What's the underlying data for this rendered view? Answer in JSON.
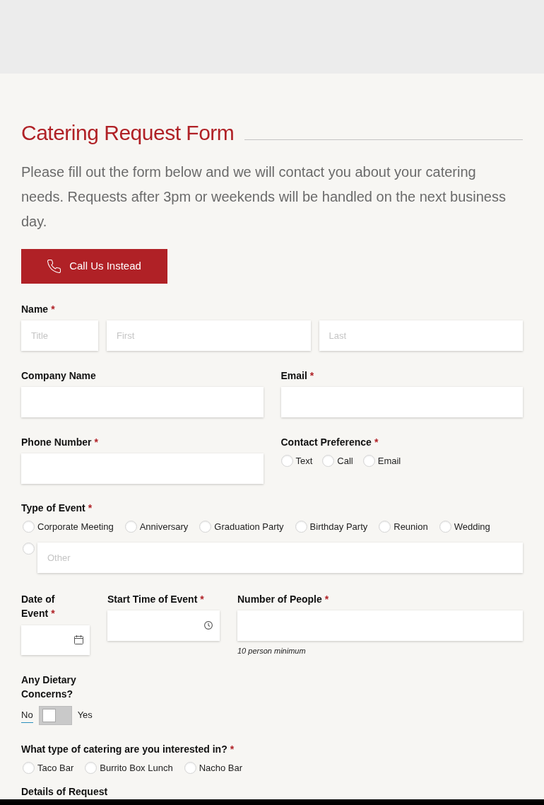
{
  "title": "Catering Request Form",
  "intro": "Please fill out the form below and we will contact you about your catering needs. Requests after 3pm or weekends will be handled on the next business day.",
  "call_button": {
    "label": "Call Us Instead"
  },
  "name": {
    "label": "Name",
    "required_mark": "*",
    "inputs": [
      {
        "placeholder": "Title"
      },
      {
        "placeholder": "First"
      },
      {
        "placeholder": "Last"
      }
    ]
  },
  "company_name": {
    "label": "Company Name"
  },
  "email": {
    "label": "Email",
    "required_mark": "*"
  },
  "phone_number": {
    "label": "Phone Number",
    "required_mark": "*"
  },
  "contact_preference": {
    "label": "Contact Preference",
    "required_mark": "*",
    "options": [
      {
        "label": "Text",
        "selected": false
      },
      {
        "label": "Call",
        "selected": false
      },
      {
        "label": "Email",
        "selected": false
      }
    ]
  },
  "type_of_event": {
    "label": "Type of Event",
    "required_mark": "*",
    "options": [
      {
        "label": "Corporate Meeting",
        "selected": false
      },
      {
        "label": "Anniversary",
        "selected": false
      },
      {
        "label": "Graduation Party",
        "selected": false
      },
      {
        "label": "Birthday Party",
        "selected": false
      },
      {
        "label": "Reunion",
        "selected": false
      },
      {
        "label": "Wedding",
        "selected": false
      }
    ],
    "other": {
      "placeholder": "Other",
      "selected": false
    }
  },
  "date_of_event": {
    "label": "Date of Event",
    "required_mark": "*"
  },
  "start_time_of_event": {
    "label": "Start Time of Event",
    "required_mark": "*"
  },
  "number_of_people": {
    "label": "Number of People",
    "required_mark": "*",
    "hint": "10 person minimum"
  },
  "dietary_concerns": {
    "label": "Any Dietary Concerns?",
    "off_label": "No",
    "on_label": "Yes",
    "on": false
  },
  "catering_type": {
    "label": "What type of catering are you interested in?",
    "required_mark": "*",
    "options": [
      {
        "label": "Taco Bar",
        "selected": false
      },
      {
        "label": "Burrito Box Lunch",
        "selected": false
      },
      {
        "label": "Nacho Bar",
        "selected": false
      }
    ]
  },
  "details_of_request": {
    "label": "Details of Request"
  }
}
